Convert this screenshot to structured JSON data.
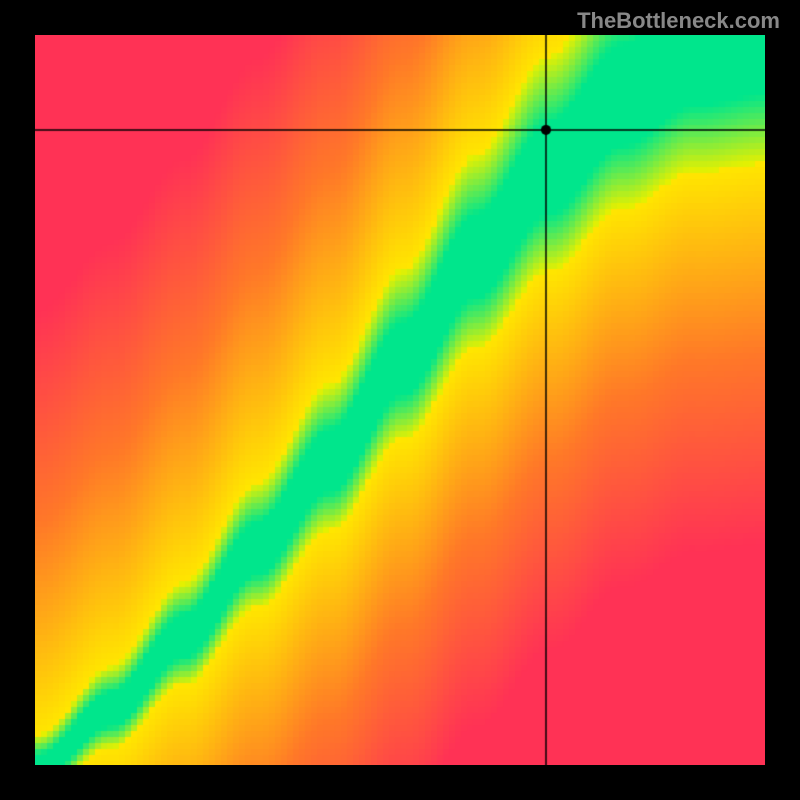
{
  "watermark": "TheBottleneck.com",
  "chart_data": {
    "type": "heatmap",
    "title": "",
    "xlabel": "",
    "ylabel": "",
    "xlim": [
      0,
      100
    ],
    "ylim": [
      0,
      100
    ],
    "crosshair": {
      "x": 70,
      "y": 87
    },
    "optimal_curve": {
      "description": "Green optimal band following a superlinear curve from bottom-left to top-right",
      "points": [
        {
          "x": 0,
          "y": 0
        },
        {
          "x": 10,
          "y": 8
        },
        {
          "x": 20,
          "y": 18
        },
        {
          "x": 30,
          "y": 30
        },
        {
          "x": 40,
          "y": 42
        },
        {
          "x": 50,
          "y": 56
        },
        {
          "x": 60,
          "y": 70
        },
        {
          "x": 70,
          "y": 82
        },
        {
          "x": 80,
          "y": 92
        },
        {
          "x": 90,
          "y": 98
        },
        {
          "x": 100,
          "y": 100
        }
      ]
    },
    "color_scale": {
      "optimal": "#00E68C",
      "near": "#FFE600",
      "mid": "#FF9933",
      "far": "#FF3355"
    }
  }
}
